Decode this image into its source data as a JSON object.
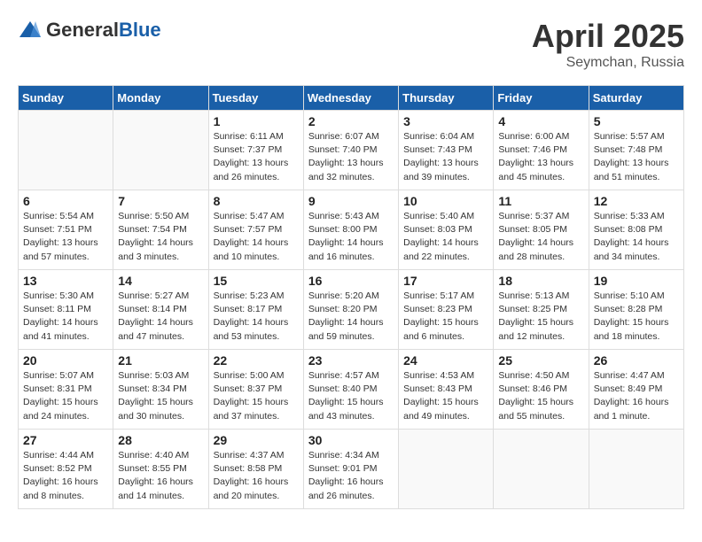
{
  "logo": {
    "text_general": "General",
    "text_blue": "Blue"
  },
  "title": "April 2025",
  "subtitle": "Seymchan, Russia",
  "days_header": [
    "Sunday",
    "Monday",
    "Tuesday",
    "Wednesday",
    "Thursday",
    "Friday",
    "Saturday"
  ],
  "weeks": [
    [
      {
        "day": "",
        "info": ""
      },
      {
        "day": "",
        "info": ""
      },
      {
        "day": "1",
        "info": "Sunrise: 6:11 AM\nSunset: 7:37 PM\nDaylight: 13 hours\nand 26 minutes."
      },
      {
        "day": "2",
        "info": "Sunrise: 6:07 AM\nSunset: 7:40 PM\nDaylight: 13 hours\nand 32 minutes."
      },
      {
        "day": "3",
        "info": "Sunrise: 6:04 AM\nSunset: 7:43 PM\nDaylight: 13 hours\nand 39 minutes."
      },
      {
        "day": "4",
        "info": "Sunrise: 6:00 AM\nSunset: 7:46 PM\nDaylight: 13 hours\nand 45 minutes."
      },
      {
        "day": "5",
        "info": "Sunrise: 5:57 AM\nSunset: 7:48 PM\nDaylight: 13 hours\nand 51 minutes."
      }
    ],
    [
      {
        "day": "6",
        "info": "Sunrise: 5:54 AM\nSunset: 7:51 PM\nDaylight: 13 hours\nand 57 minutes."
      },
      {
        "day": "7",
        "info": "Sunrise: 5:50 AM\nSunset: 7:54 PM\nDaylight: 14 hours\nand 3 minutes."
      },
      {
        "day": "8",
        "info": "Sunrise: 5:47 AM\nSunset: 7:57 PM\nDaylight: 14 hours\nand 10 minutes."
      },
      {
        "day": "9",
        "info": "Sunrise: 5:43 AM\nSunset: 8:00 PM\nDaylight: 14 hours\nand 16 minutes."
      },
      {
        "day": "10",
        "info": "Sunrise: 5:40 AM\nSunset: 8:03 PM\nDaylight: 14 hours\nand 22 minutes."
      },
      {
        "day": "11",
        "info": "Sunrise: 5:37 AM\nSunset: 8:05 PM\nDaylight: 14 hours\nand 28 minutes."
      },
      {
        "day": "12",
        "info": "Sunrise: 5:33 AM\nSunset: 8:08 PM\nDaylight: 14 hours\nand 34 minutes."
      }
    ],
    [
      {
        "day": "13",
        "info": "Sunrise: 5:30 AM\nSunset: 8:11 PM\nDaylight: 14 hours\nand 41 minutes."
      },
      {
        "day": "14",
        "info": "Sunrise: 5:27 AM\nSunset: 8:14 PM\nDaylight: 14 hours\nand 47 minutes."
      },
      {
        "day": "15",
        "info": "Sunrise: 5:23 AM\nSunset: 8:17 PM\nDaylight: 14 hours\nand 53 minutes."
      },
      {
        "day": "16",
        "info": "Sunrise: 5:20 AM\nSunset: 8:20 PM\nDaylight: 14 hours\nand 59 minutes."
      },
      {
        "day": "17",
        "info": "Sunrise: 5:17 AM\nSunset: 8:23 PM\nDaylight: 15 hours\nand 6 minutes."
      },
      {
        "day": "18",
        "info": "Sunrise: 5:13 AM\nSunset: 8:25 PM\nDaylight: 15 hours\nand 12 minutes."
      },
      {
        "day": "19",
        "info": "Sunrise: 5:10 AM\nSunset: 8:28 PM\nDaylight: 15 hours\nand 18 minutes."
      }
    ],
    [
      {
        "day": "20",
        "info": "Sunrise: 5:07 AM\nSunset: 8:31 PM\nDaylight: 15 hours\nand 24 minutes."
      },
      {
        "day": "21",
        "info": "Sunrise: 5:03 AM\nSunset: 8:34 PM\nDaylight: 15 hours\nand 30 minutes."
      },
      {
        "day": "22",
        "info": "Sunrise: 5:00 AM\nSunset: 8:37 PM\nDaylight: 15 hours\nand 37 minutes."
      },
      {
        "day": "23",
        "info": "Sunrise: 4:57 AM\nSunset: 8:40 PM\nDaylight: 15 hours\nand 43 minutes."
      },
      {
        "day": "24",
        "info": "Sunrise: 4:53 AM\nSunset: 8:43 PM\nDaylight: 15 hours\nand 49 minutes."
      },
      {
        "day": "25",
        "info": "Sunrise: 4:50 AM\nSunset: 8:46 PM\nDaylight: 15 hours\nand 55 minutes."
      },
      {
        "day": "26",
        "info": "Sunrise: 4:47 AM\nSunset: 8:49 PM\nDaylight: 16 hours\nand 1 minute."
      }
    ],
    [
      {
        "day": "27",
        "info": "Sunrise: 4:44 AM\nSunset: 8:52 PM\nDaylight: 16 hours\nand 8 minutes."
      },
      {
        "day": "28",
        "info": "Sunrise: 4:40 AM\nSunset: 8:55 PM\nDaylight: 16 hours\nand 14 minutes."
      },
      {
        "day": "29",
        "info": "Sunrise: 4:37 AM\nSunset: 8:58 PM\nDaylight: 16 hours\nand 20 minutes."
      },
      {
        "day": "30",
        "info": "Sunrise: 4:34 AM\nSunset: 9:01 PM\nDaylight: 16 hours\nand 26 minutes."
      },
      {
        "day": "",
        "info": ""
      },
      {
        "day": "",
        "info": ""
      },
      {
        "day": "",
        "info": ""
      }
    ]
  ]
}
